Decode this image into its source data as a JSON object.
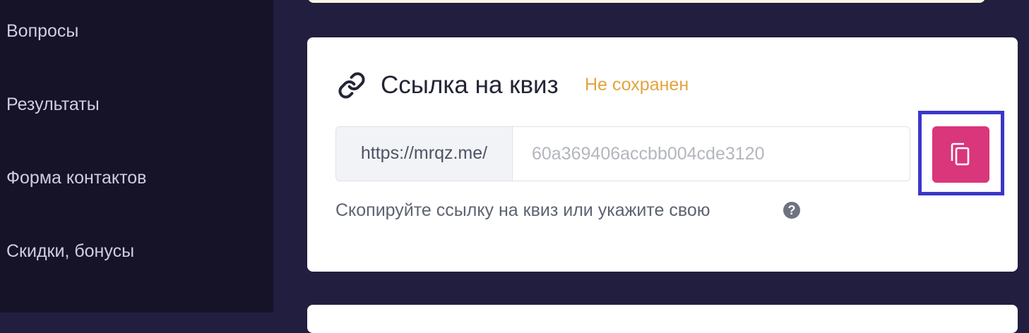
{
  "sidebar": {
    "items": [
      {
        "label": "Вопросы"
      },
      {
        "label": "Результаты"
      },
      {
        "label": "Форма контактов"
      },
      {
        "label": "Скидки, бонусы"
      }
    ]
  },
  "link_section": {
    "icon": "link-icon",
    "title": "Ссылка на квиз",
    "status": "Не сохранен",
    "url_prefix": "https://mrqz.me/",
    "slug_value": "",
    "slug_placeholder": "60a369406accbb004cde3120",
    "copy_icon": "copy-icon",
    "helper_text": "Скопируйте ссылку на квиз или укажите свою",
    "help_icon": "question-circle-icon",
    "help_glyph": "?"
  },
  "colors": {
    "background": "#211e3f",
    "sidebar": "#161329",
    "accent": "#d9367b",
    "status": "#e2a43d",
    "highlight": "#3a37c9"
  }
}
